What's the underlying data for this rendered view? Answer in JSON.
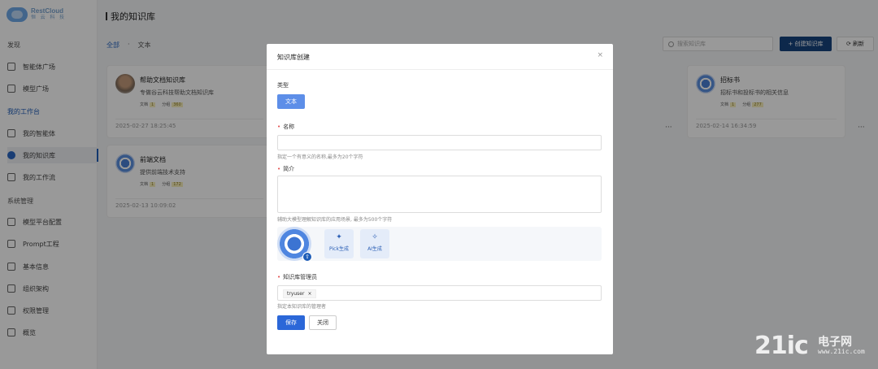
{
  "app": {
    "logo_name": "RestCloud",
    "logo_sub": "恒 云 科 技",
    "page_title": "我的知识库"
  },
  "sidebar": {
    "groups": [
      "发现",
      "我的工作台",
      "系统管理"
    ],
    "items": [
      {
        "label": "智能体广场",
        "icon": "home-icon"
      },
      {
        "label": "模型广场",
        "icon": "model-icon"
      },
      {
        "label": "我的智能体",
        "icon": "monitor-icon"
      },
      {
        "label": "我的知识库",
        "icon": "knowledge-icon"
      },
      {
        "label": "我的工作流",
        "icon": "workflow-icon"
      },
      {
        "label": "模型平台配置",
        "icon": "cube-icon"
      },
      {
        "label": "Prompt工程",
        "icon": "prompt-icon"
      },
      {
        "label": "基本信息",
        "icon": "info-icon"
      },
      {
        "label": "组织架构",
        "icon": "org-icon"
      },
      {
        "label": "权限管理",
        "icon": "permission-icon"
      },
      {
        "label": "概览",
        "icon": "overview-icon"
      }
    ]
  },
  "toolbar": {
    "tab_all": "全部",
    "tab_text": "文本",
    "search_placeholder": "搜索知识库",
    "create_label": "+ 创建知识库",
    "refresh_label": "刷新"
  },
  "cards": [
    {
      "title": "帮助文档知识库",
      "desc": "专做谷云科技帮助文档知识库",
      "type_label": "文档",
      "type_val": "1",
      "cat_label": "分组",
      "cat_val": "360",
      "date": "2025-02-27 18:25:45",
      "more": "···"
    },
    {
      "title": "前端文档",
      "desc": "提供前端技术支持",
      "type_label": "文档",
      "type_val": "1",
      "cat_label": "分组",
      "cat_val": "172",
      "date": "2025-02-13 10:09:02",
      "more": ""
    },
    {
      "title": "招标书",
      "desc": "招标书和投标书的相关信息",
      "type_label": "文档",
      "type_val": "1",
      "cat_label": "分组",
      "cat_val": "277",
      "date": "2025-02-14 16:34:59",
      "more": "···"
    }
  ],
  "card_more_symbol": "···",
  "modal": {
    "title": "知识库创建",
    "close": "×",
    "type_label": "类型",
    "type_value": "文本",
    "name_label": "名称",
    "name_value": "",
    "name_hint": "指定一个有意义的名称,最多为20个字符",
    "intro_label": "简介",
    "intro_value": "",
    "intro_hint": "辅助大模型理解知识库的应用场景, 最多为500个字符",
    "pick_label": "Pick生成",
    "ai_label": "AI生成",
    "admin_label": "知识库管理员",
    "admin_value": "tryuser",
    "admin_remove": "×",
    "admin_hint": "指定本知识库的管理者",
    "save_label": "保存",
    "cancel_label": "关闭",
    "required_mark": "•"
  },
  "watermark": {
    "big": "21ic",
    "small": "电子网",
    "url": "www.21ic.com"
  }
}
